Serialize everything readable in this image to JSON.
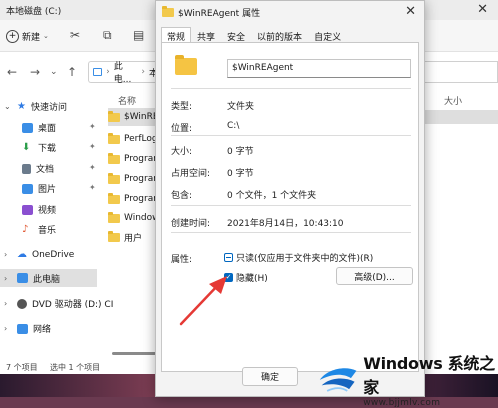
{
  "explorer": {
    "title": "本地磁盘 (C:)",
    "toolbar": {
      "new_label": "新建"
    },
    "address": {
      "part1": "此电...",
      "part2": "本"
    },
    "sidebar": [
      {
        "label": "快速访问",
        "icon": "star-icon",
        "color": "#2f7be4"
      },
      {
        "label": "桌面",
        "icon": "desktop-icon",
        "color": "#3a8ee6"
      },
      {
        "label": "下载",
        "icon": "download-icon",
        "color": "#2a9d4a"
      },
      {
        "label": "文档",
        "icon": "document-icon",
        "color": "#6b7b8c"
      },
      {
        "label": "图片",
        "icon": "picture-icon",
        "color": "#3a8ee6"
      },
      {
        "label": "视频",
        "icon": "video-icon",
        "color": "#8a4fd0"
      },
      {
        "label": "音乐",
        "icon": "music-icon",
        "color": "#e0542e"
      },
      {
        "label": "OneDrive",
        "icon": "cloud-icon",
        "color": "#2f7be4"
      },
      {
        "label": "此电脑",
        "icon": "computer-icon",
        "color": "#3a8ee6"
      },
      {
        "label": "DVD 驱动器 (D:) CI",
        "icon": "dvd-icon",
        "color": "#555555"
      },
      {
        "label": "网络",
        "icon": "network-icon",
        "color": "#3a8ee6"
      }
    ],
    "columns": {
      "name": "名称",
      "size": "大小"
    },
    "files": [
      "$WinREA",
      "PerfLogs",
      "Program",
      "Program",
      "Program",
      "Windows",
      "用户"
    ],
    "status": {
      "count": "7 个项目",
      "selected": "选中 1 个项目"
    }
  },
  "dialog": {
    "title": "$WinREAgent 属性",
    "tabs": [
      "常规",
      "共享",
      "安全",
      "以前的版本",
      "自定义"
    ],
    "active_tab": 0,
    "name_value": "$WinREAgent",
    "props": [
      {
        "label": "类型:",
        "value": "文件夹"
      },
      {
        "label": "位置:",
        "value": "C:\\"
      },
      {
        "label": "大小:",
        "value": "0 字节"
      },
      {
        "label": "占用空间:",
        "value": "0 字节"
      },
      {
        "label": "包含:",
        "value": "0 个文件，1 个文件夹"
      },
      {
        "label": "创建时间:",
        "value": "2021年8月14日，10:43:10"
      }
    ],
    "attributes_label": "属性:",
    "readonly_label": "只读(仅应用于文件夹中的文件)(R)",
    "readonly_state": "indeterminate",
    "hidden_label": "隐藏(H)",
    "hidden_checked": true,
    "advanced_label": "高级(D)...",
    "ok_label": "确定"
  },
  "watermark": {
    "brand": "Windows",
    "brand_cn": "系统之家",
    "url": "www.bjjmlv.com"
  },
  "colors": {
    "accent": "#0067c0",
    "arrow": "#e53935"
  }
}
